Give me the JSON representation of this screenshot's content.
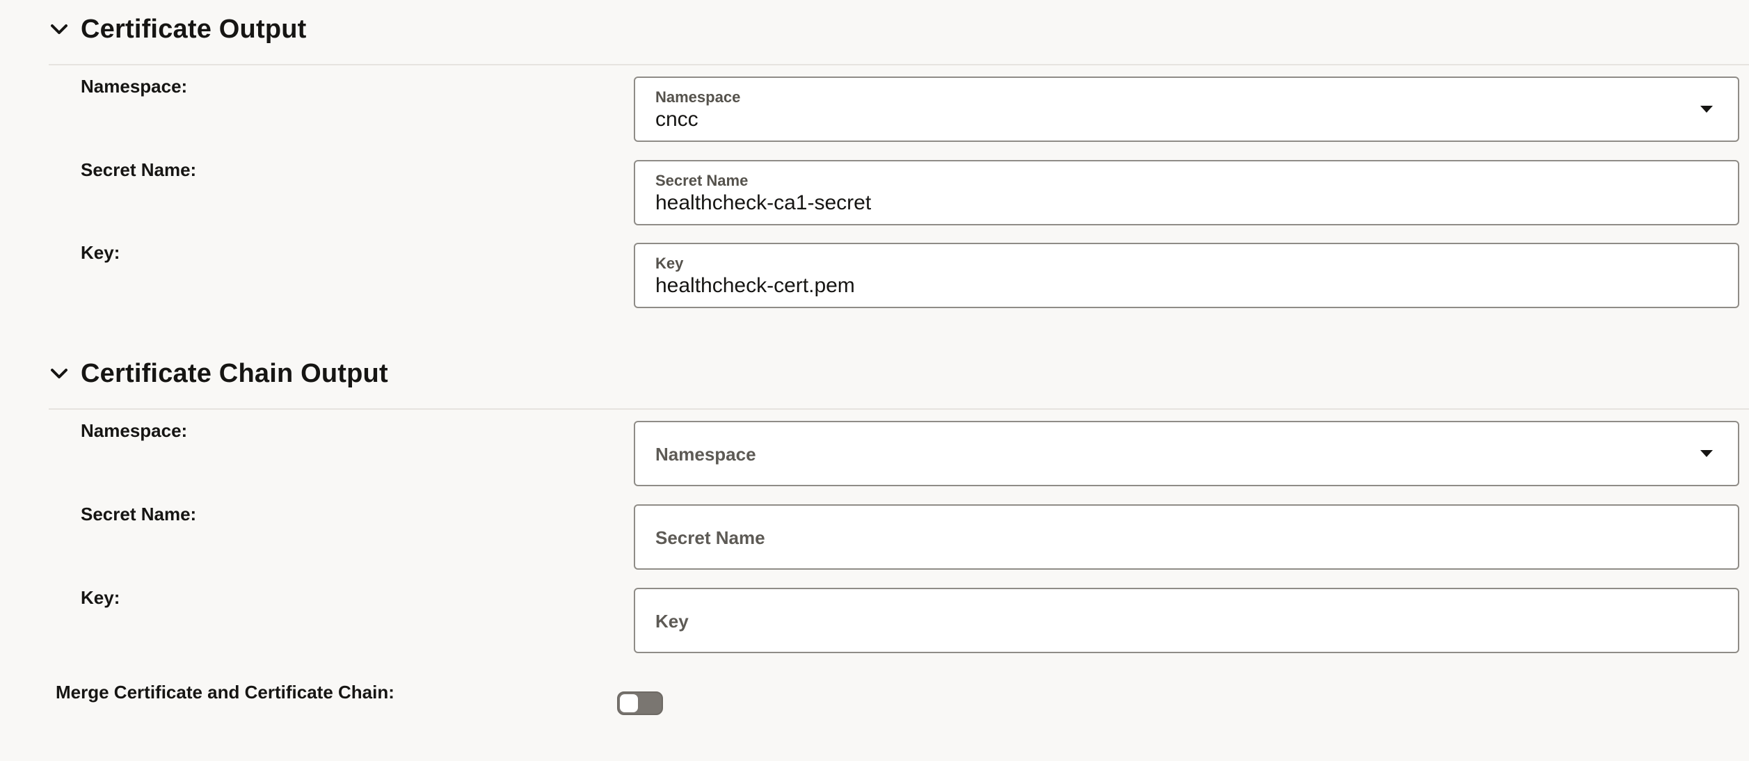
{
  "certificate_output": {
    "title": "Certificate Output",
    "namespace_label": "Namespace:",
    "namespace_field": {
      "label": "Namespace",
      "value": "cncc"
    },
    "secret_name_label": "Secret Name:",
    "secret_name_field": {
      "label": "Secret Name",
      "value": "healthcheck-ca1-secret"
    },
    "key_label": "Key:",
    "key_field": {
      "label": "Key",
      "value": "healthcheck-cert.pem"
    }
  },
  "certificate_chain_output": {
    "title": "Certificate Chain Output",
    "namespace_label": "Namespace:",
    "namespace_field": {
      "placeholder": "Namespace",
      "value": ""
    },
    "secret_name_label": "Secret Name:",
    "secret_name_field": {
      "placeholder": "Secret Name",
      "value": ""
    },
    "key_label": "Key:",
    "key_field": {
      "placeholder": "Key",
      "value": ""
    }
  },
  "merge": {
    "label": "Merge Certificate and Certificate Chain:",
    "enabled": false
  },
  "icons": {
    "collapse": "chevron-down-icon",
    "dropdown": "caret-down-icon"
  },
  "colors": {
    "background": "#f9f8f6",
    "text": "#161513",
    "field_border": "#8f8c87",
    "toggle_off": "#7a7671"
  }
}
